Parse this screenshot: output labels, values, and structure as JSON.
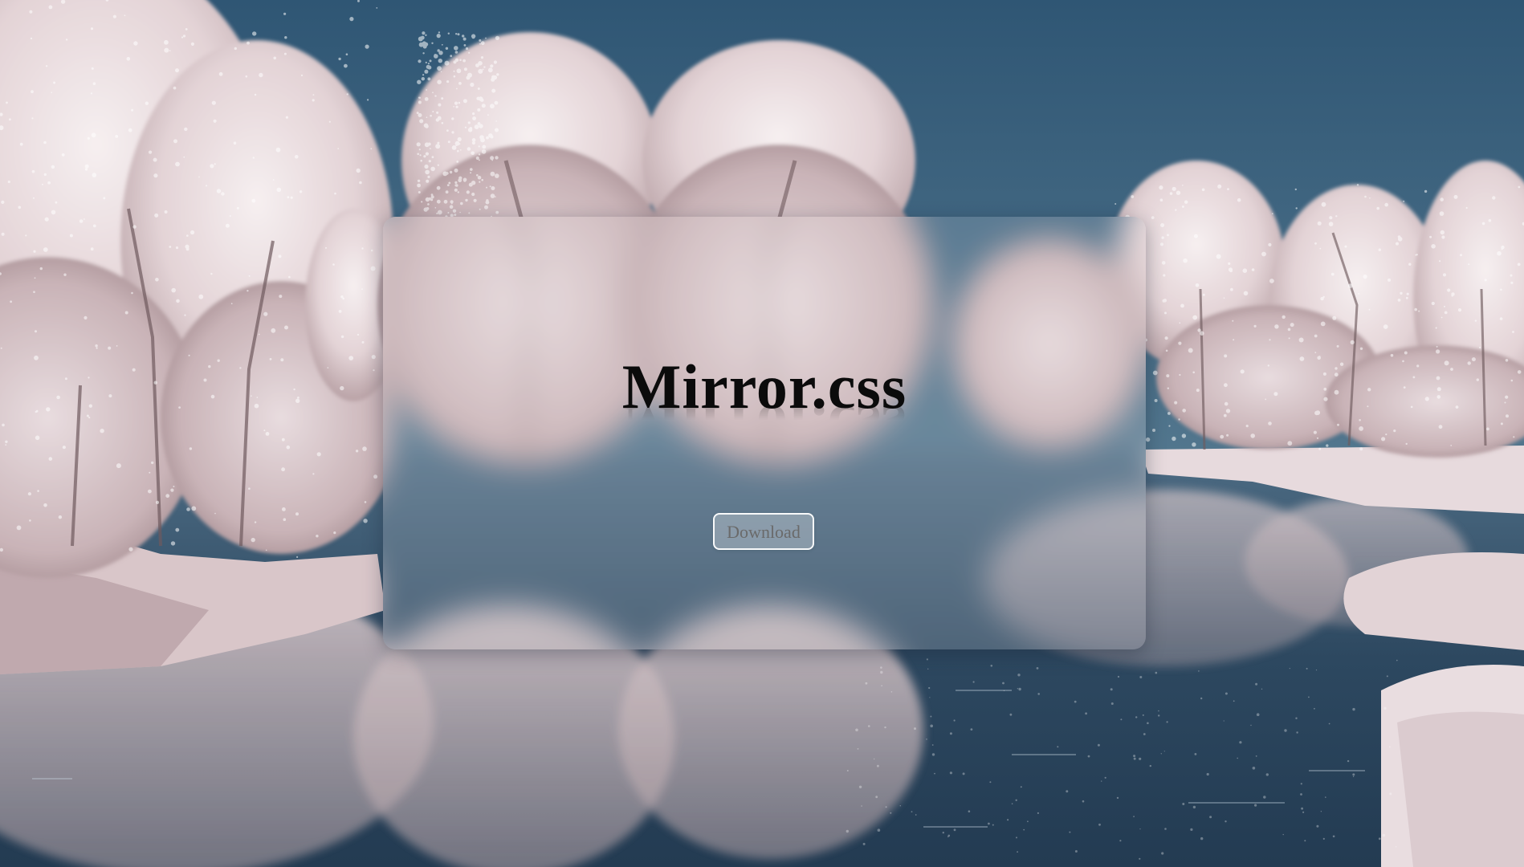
{
  "page": {
    "brand_title": "Mirror.css",
    "download_label": "Download"
  },
  "colors": {
    "sky_top": "#2f5674",
    "sky_bottom": "#4a7290",
    "water": "#34506a",
    "frost": "#efe6e8",
    "title_text": "#0b0b0b",
    "button_text": "#6a6a6a"
  },
  "background": {
    "description_icon": "frosted-lake-scene"
  }
}
